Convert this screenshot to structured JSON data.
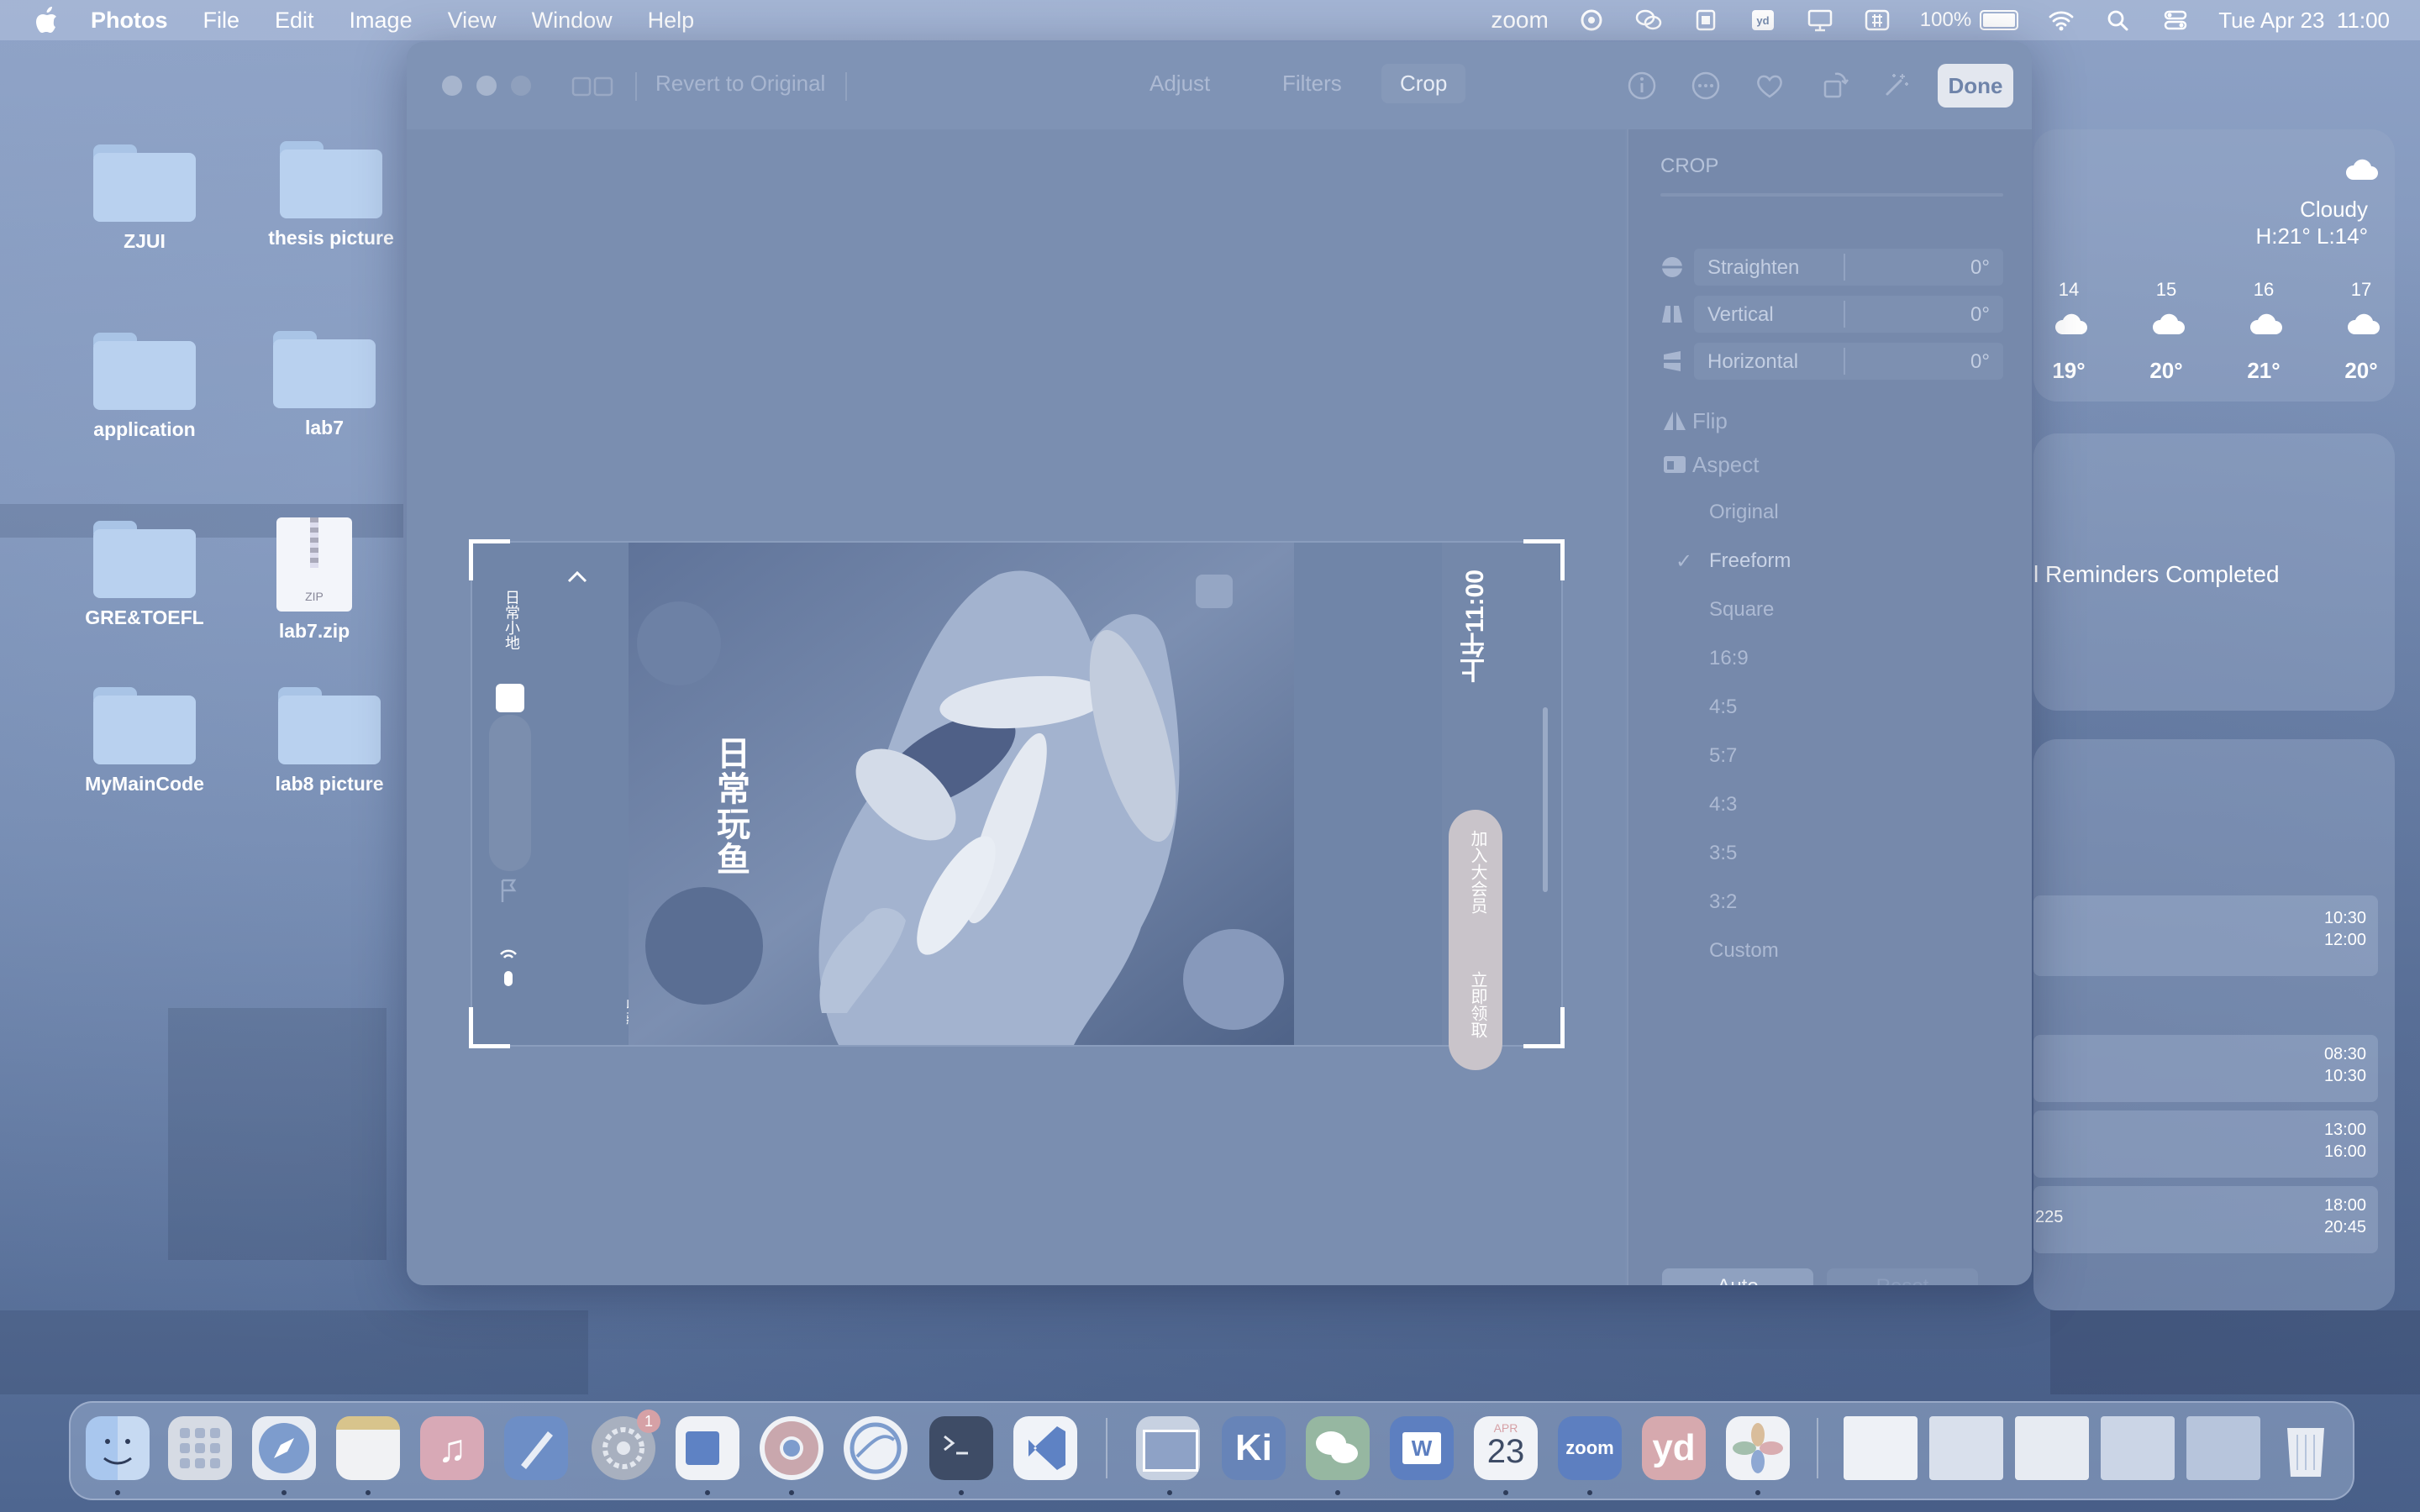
{
  "menubar": {
    "app_name": "Photos",
    "menus": [
      "File",
      "Edit",
      "Image",
      "View",
      "Window",
      "Help"
    ],
    "zoom_label": "zoom",
    "battery": "100%",
    "datetime": "Tue Apr 23  11:00"
  },
  "desktop": {
    "icons": [
      {
        "label": "ZJUI"
      },
      {
        "label": "thesis picture"
      },
      {
        "label": "application"
      },
      {
        "label": "lab7"
      },
      {
        "label": "GRE&TOEFL"
      },
      {
        "label": "lab7.zip",
        "badge": "ZIP"
      },
      {
        "label": "MyMainCode"
      },
      {
        "label": "lab8 picture"
      }
    ]
  },
  "photos_window": {
    "revert_label": "Revert to Original",
    "tabs": [
      "Adjust",
      "Filters",
      "Crop"
    ],
    "active_tab": "Crop",
    "done_label": "Done",
    "photo": {
      "overlay_text_vertical": "日常玩鱼",
      "right_time": "上午11:00",
      "pill_top": "加入大会员",
      "pill_bottom": "立即领取",
      "left_text": "日常小地",
      "left_bottom": "收藏"
    },
    "panel": {
      "title": "CROP",
      "sliders": [
        {
          "label": "Straighten",
          "value": "0°",
          "icon": "straighten-icon"
        },
        {
          "label": "Vertical",
          "value": "0°",
          "icon": "vertical-perspective-icon"
        },
        {
          "label": "Horizontal",
          "value": "0°",
          "icon": "horizontal-perspective-icon"
        }
      ],
      "flip_label": "Flip",
      "aspect_label": "Aspect",
      "aspect_options": [
        "Original",
        "Freeform",
        "Square",
        "16:9",
        "4:5",
        "5:7",
        "4:3",
        "3:5",
        "3:2",
        "Custom"
      ],
      "selected_aspect": "Freeform",
      "auto_label": "Auto",
      "reset_label": "Reset"
    }
  },
  "weather_widget": {
    "condition": "Cloudy",
    "hi_lo": "H:21° L:14°",
    "hours": [
      {
        "hour": "14",
        "temp": "19°"
      },
      {
        "hour": "15",
        "temp": "20°"
      },
      {
        "hour": "16",
        "temp": "21°"
      },
      {
        "hour": "17",
        "temp": "20°"
      }
    ]
  },
  "reminders_widget": {
    "text": "l Reminders Completed"
  },
  "calendar_widget": {
    "times": [
      {
        "start": "10:30",
        "end": "12:00"
      },
      {
        "start": "08:30",
        "end": "10:30"
      },
      {
        "start": "13:00",
        "end": "16:00"
      },
      {
        "start": "18:00",
        "end": "20:45"
      }
    ],
    "side_number": "225"
  },
  "dock": {
    "calendar_month": "APR",
    "calendar_day": "23",
    "zoom_label": "zoom",
    "ki_label": "Ki",
    "yd_label": "yd",
    "word_label": "W",
    "settings_badge": "1",
    "apps": [
      "Finder",
      "Launchpad",
      "Safari",
      "Notes",
      "Music",
      "Xcode",
      "System Settings",
      "Outlook",
      "Chrome",
      "Browser",
      "Terminal",
      "VS Code",
      "Preview",
      "Keynote",
      "WeChat",
      "Word",
      "Calendar",
      "Zoom",
      "Youdao",
      "Photos",
      "Trash"
    ]
  },
  "colors": {
    "tint": "#7a8eb0",
    "done_button_bg": "#e3e7ef",
    "crop_handles": "#ffffff"
  }
}
